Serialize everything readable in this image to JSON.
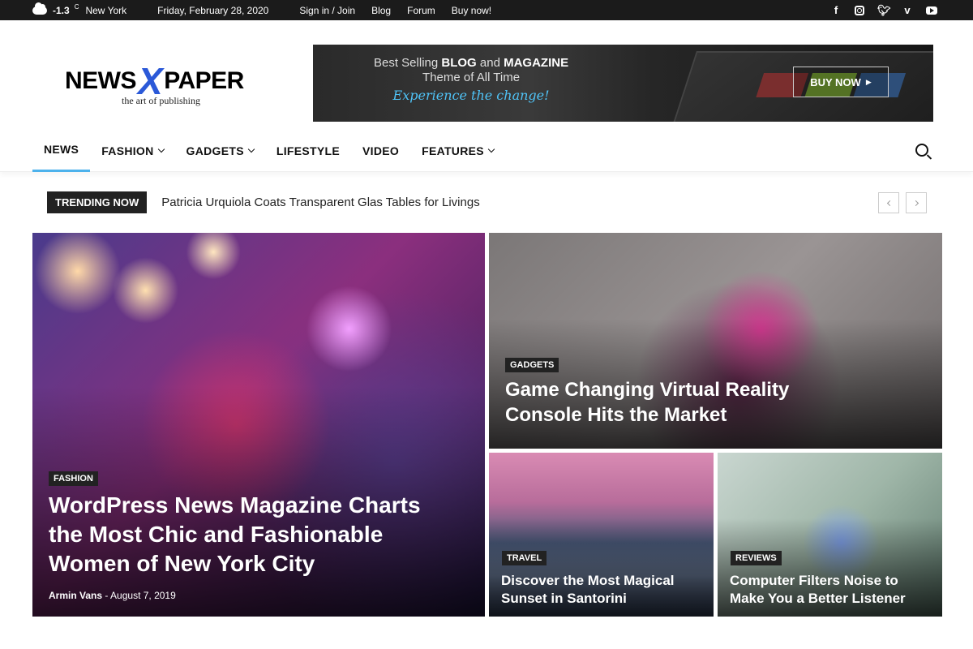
{
  "topbar": {
    "temperature": "-1.3",
    "unit": "C",
    "city": "New York",
    "date": "Friday, February 28, 2020",
    "links": [
      "Sign in / Join",
      "Blog",
      "Forum",
      "Buy now!"
    ],
    "social_icons": [
      "facebook-icon",
      "instagram-icon",
      "twitter-icon",
      "vimeo-icon",
      "youtube-icon"
    ]
  },
  "logo": {
    "left": "NEWS",
    "x": "X",
    "right": "PAPER",
    "tagline": "the art of publishing"
  },
  "banner": {
    "line1_prefix": "Best Selling ",
    "line1_blog": "BLOG",
    "line1_and": " and ",
    "line1_magazine": "MAGAZINE",
    "line2": "Theme of All Time",
    "line3": "Experience the change!",
    "button": "BUY NOW"
  },
  "nav": {
    "items": [
      {
        "label": "NEWS",
        "active": true,
        "dropdown": false
      },
      {
        "label": "FASHION",
        "dropdown": true
      },
      {
        "label": "GADGETS",
        "dropdown": true
      },
      {
        "label": "LIFESTYLE",
        "dropdown": false
      },
      {
        "label": "VIDEO",
        "dropdown": false
      },
      {
        "label": "FEATURES",
        "dropdown": true
      }
    ]
  },
  "trending": {
    "badge": "TRENDING NOW",
    "headline": "Patricia Urquiola Coats Transparent Glas Tables for Livings"
  },
  "featured": [
    {
      "category": "FASHION",
      "title": "WordPress News Magazine Charts the Most Chic and Fashionable Women of New York City",
      "author": "Armin Vans",
      "date": "August 7, 2019"
    },
    {
      "category": "GADGETS",
      "title": "Game Changing Virtual Reality Console Hits the Market"
    },
    {
      "category": "TRAVEL",
      "title": "Discover the Most Magical Sunset in Santorini"
    },
    {
      "category": "REVIEWS",
      "title": "Computer Filters Noise to Make You a Better Listener"
    }
  ],
  "colors": {
    "accent": "#4db2ec",
    "topbar_bg": "#1b1b1b",
    "logo_x": "#2b59d8",
    "banner_script": "#4fc3f7"
  }
}
